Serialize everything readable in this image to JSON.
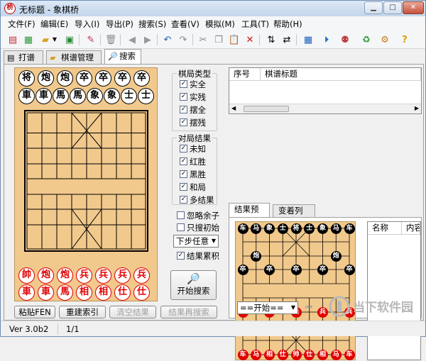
{
  "window": {
    "title": "无标题 - 象棋桥",
    "icon_char": "桥"
  },
  "menu": [
    "文件(F)",
    "编辑(E)",
    "导入(I)",
    "导出(P)",
    "搜索(S)",
    "查看(V)",
    "模拟(M)",
    "工具(T)",
    "帮助(H)"
  ],
  "toolbar": {
    "icons": [
      "new-book-icon",
      "new-game-icon",
      "open-icon",
      "dropdown-arrow-icon",
      "save-icon",
      "edit-icon",
      "delete-icon",
      "back-icon",
      "forward-icon",
      "undo-icon",
      "redo-icon",
      "cut-icon",
      "copy-icon",
      "paste-icon",
      "remove-icon",
      "swap-vertical-icon",
      "swap-horizontal-icon",
      "board-view-icon",
      "play-icon",
      "pieces-icon",
      "recycle-icon",
      "engine-icon",
      "help-icon"
    ]
  },
  "tabs": [
    {
      "label": "打谱"
    },
    {
      "label": "棋谱管理"
    },
    {
      "label": "搜索"
    }
  ],
  "board_top": {
    "black_pieces": [
      "将",
      "炮",
      "炮",
      "卒",
      "卒",
      "卒",
      "卒",
      "車",
      "車",
      "馬",
      "馬",
      "象",
      "象",
      "士",
      "士"
    ],
    "red_pieces_row1": [
      "帥",
      "炮",
      "炮",
      "兵",
      "兵",
      "兵",
      "兵"
    ],
    "red_pieces_row2": [
      "車",
      "車",
      "馬",
      "相",
      "相",
      "仕",
      "仕"
    ]
  },
  "game_type": {
    "title": "棋局类型",
    "options": [
      {
        "label": "实全",
        "checked": true
      },
      {
        "label": "实残",
        "checked": true
      },
      {
        "label": "摆全",
        "checked": true
      },
      {
        "label": "摆残",
        "checked": true
      }
    ]
  },
  "game_result": {
    "title": "对局结果",
    "options": [
      {
        "label": "未知",
        "checked": true
      },
      {
        "label": "红胜",
        "checked": true
      },
      {
        "label": "黑胜",
        "checked": true
      },
      {
        "label": "和局",
        "checked": true
      },
      {
        "label": "多结果",
        "checked": true
      }
    ]
  },
  "options": {
    "ignore_rest": {
      "label": "忽略余子",
      "checked": false
    },
    "search_start": {
      "label": "只搜初始",
      "checked": false
    },
    "next_move": "下步任意",
    "accumulate": {
      "label": "结果累积",
      "checked": true
    }
  },
  "buttons": {
    "start_search": "开始搜索",
    "paste_fen": "粘贴FEN",
    "rebuild_index": "重建索引",
    "clear_results": "清空结果",
    "search_results": "结果再搜索"
  },
  "list1": {
    "columns": [
      "序号",
      "棋谱标题"
    ]
  },
  "tabs2": [
    {
      "label": "结果预览"
    },
    {
      "label": "变着列表"
    }
  ],
  "preview": {
    "start_select": "==开始==",
    "list_columns": [
      "名称",
      "内容"
    ],
    "black_top": [
      "车",
      "马",
      "象",
      "士",
      "将",
      "士",
      "象",
      "马",
      "车"
    ],
    "black_cannons": [
      "炮",
      "炮"
    ],
    "black_soldiers": [
      "卒",
      "卒",
      "卒",
      "卒",
      "卒"
    ],
    "red_soldiers": [
      "兵",
      "兵",
      "兵",
      "兵",
      "兵"
    ],
    "red_cannons": [
      "炮",
      "炮"
    ],
    "red_bottom": [
      "车",
      "马",
      "相",
      "仕",
      "帅",
      "仕",
      "相",
      "马",
      "车"
    ]
  },
  "status": {
    "version": "Ver 3.0b2",
    "page": "1/1"
  },
  "watermark": "当下软件园"
}
